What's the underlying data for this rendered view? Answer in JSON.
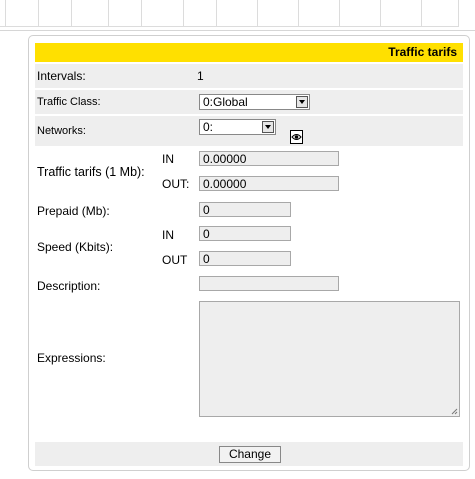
{
  "title": "Traffic tarifs",
  "intervals": {
    "label": "Intervals:",
    "value": "1"
  },
  "traffic_class": {
    "label": "Traffic Class:",
    "selected": "0:Global"
  },
  "networks": {
    "label": "Networks:",
    "selected": "0:",
    "icon": "view-icon"
  },
  "traffic_tarifs": {
    "label": "Traffic tarifs (1 Mb):",
    "in_label": "IN",
    "in_value": "0.00000",
    "out_label": "OUT:",
    "out_value": "0.00000"
  },
  "prepaid": {
    "label": "Prepaid (Mb):",
    "value": "0"
  },
  "speed": {
    "label": "Speed (Kbits):",
    "in_label": "IN",
    "in_value": "0",
    "out_label": "OUT",
    "out_value": "0"
  },
  "description": {
    "label": "Description:",
    "value": ""
  },
  "expressions": {
    "label": "Expressions:",
    "value": ""
  },
  "submit": {
    "label": "Change"
  },
  "colors": {
    "title_bg": "#ffe000",
    "row_gray": "#eeeeee"
  }
}
